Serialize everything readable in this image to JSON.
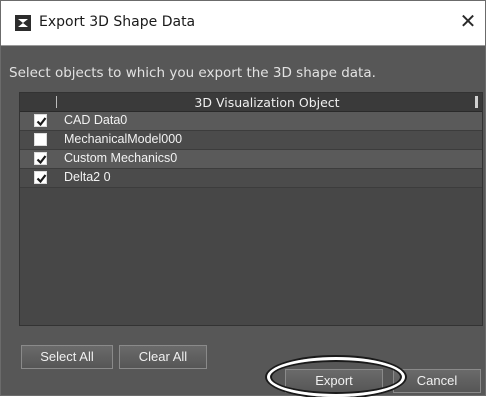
{
  "window": {
    "title": "Export 3D Shape Data",
    "close_glyph": "✕"
  },
  "instruction": "Select objects to which you export the 3D shape data.",
  "table": {
    "header": "3D Visualization Object",
    "rows": [
      {
        "label": "CAD Data0",
        "checked": true
      },
      {
        "label": "MechanicalModel000",
        "checked": false
      },
      {
        "label": "Custom Mechanics0",
        "checked": true
      },
      {
        "label": "Delta2 0",
        "checked": true
      }
    ]
  },
  "buttons": {
    "select_all": "Select All",
    "clear_all": "Clear All",
    "export": "Export",
    "cancel": "Cancel"
  },
  "icons": {
    "app": "app-logo-icon",
    "close": "close-icon",
    "checkmark": "checkmark-icon"
  }
}
